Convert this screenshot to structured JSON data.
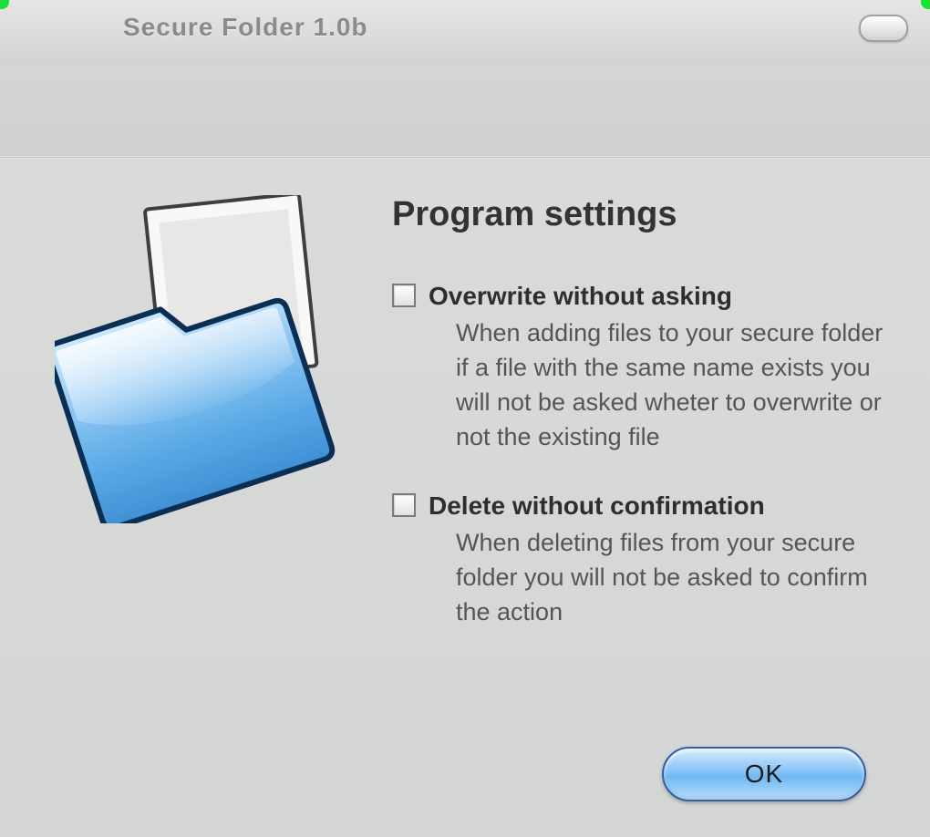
{
  "window": {
    "title": "Secure Folder 1.0b"
  },
  "panel": {
    "heading": "Program settings",
    "options": [
      {
        "label": "Overwrite without asking",
        "description": "When adding files to your secure folder if a file with the same name exists you will not be asked wheter to overwrite or not the existing file",
        "checked": false
      },
      {
        "label": "Delete without confirmation",
        "description": "When deleting files from your secure folder you will not be asked to confirm the action",
        "checked": false
      }
    ],
    "ok_label": "OK"
  },
  "icons": {
    "folder": "folder-icon",
    "minimize_pill": "minimize-icon"
  }
}
